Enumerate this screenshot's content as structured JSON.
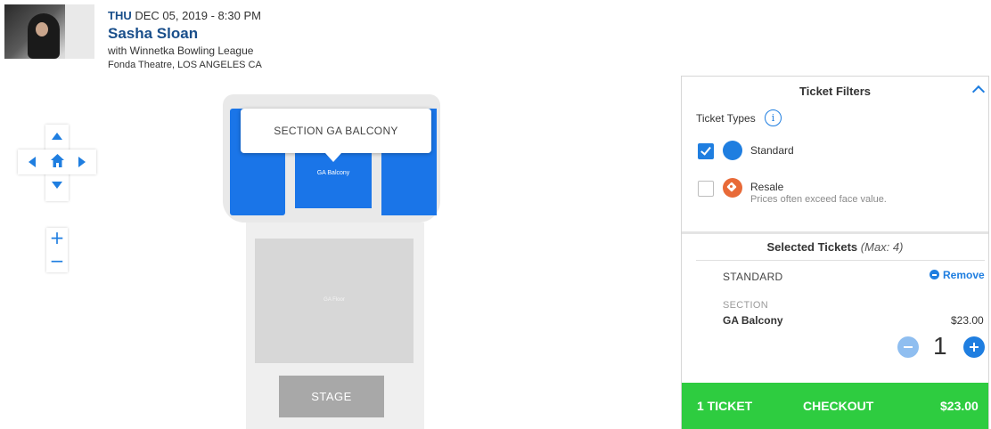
{
  "event": {
    "day": "THU",
    "date_time": "DEC 05, 2019 - 8:30 PM",
    "artist": "Sasha Sloan",
    "support": "with Winnetka Bowling League",
    "venue": "Fonda Theatre, LOS ANGELES CA"
  },
  "map": {
    "tooltip": "SECTION GA BALCONY",
    "section_mid_label": "GA Balcony",
    "floor_label": "GA Floor",
    "stage_label": "STAGE",
    "zoom_in": "+",
    "zoom_out": "−",
    "section_color": "#1a75e8"
  },
  "filters": {
    "title": "Ticket Filters",
    "ticket_types_label": "Ticket Types",
    "info_glyph": "i",
    "standard": {
      "label": "Standard",
      "checked": true,
      "color": "#1f7ee0"
    },
    "resale": {
      "label": "Resale",
      "note": "Prices often exceed face value.",
      "checked": false,
      "color": "#e86a38"
    }
  },
  "selected": {
    "title": "Selected Tickets",
    "max_note": "(Max: 4)",
    "ticket_type": "STANDARD",
    "remove_label": "Remove",
    "section_caption": "SECTION",
    "section_name": "GA Balcony",
    "price": "$23.00",
    "quantity": "1"
  },
  "checkout": {
    "count_label": "1 TICKET",
    "button_label": "CHECKOUT",
    "total": "$23.00",
    "color": "#2ecc40"
  }
}
